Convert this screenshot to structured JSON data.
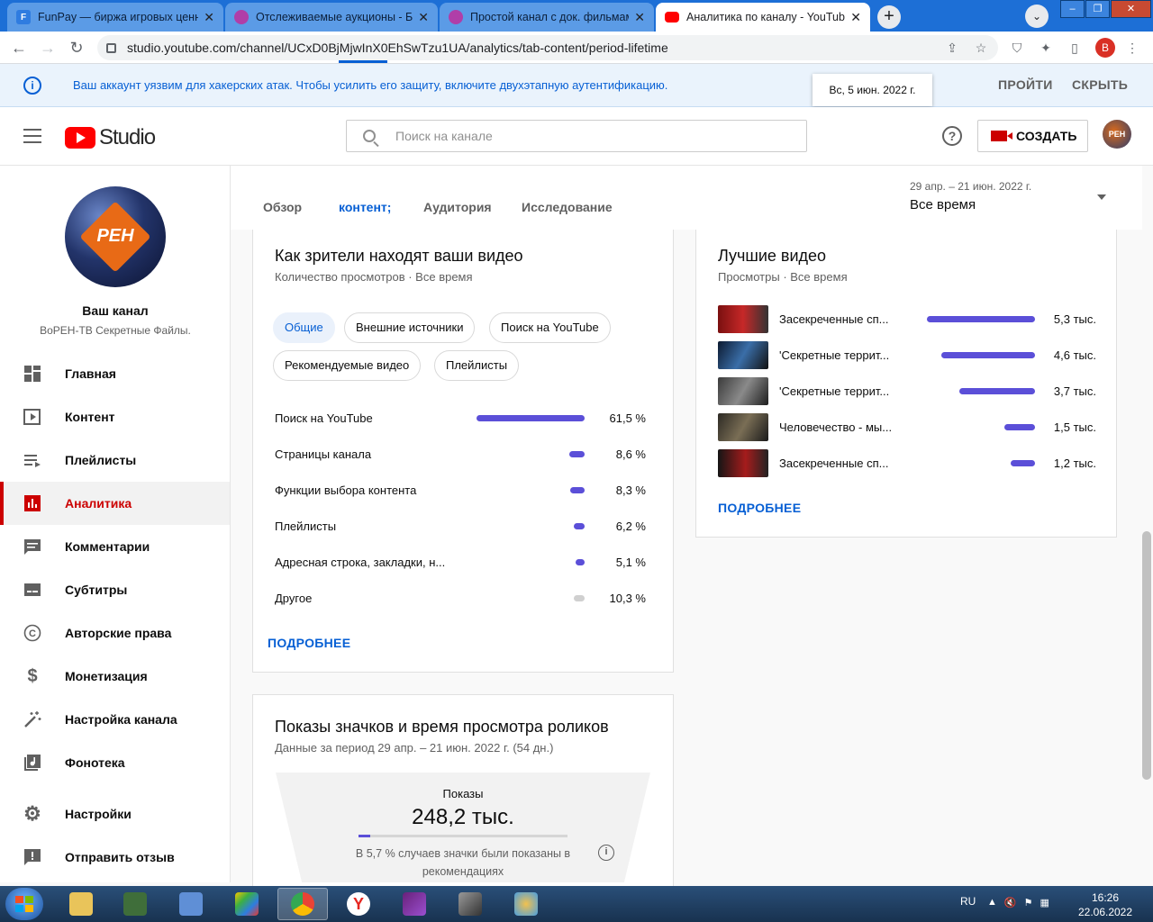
{
  "browser": {
    "tabs": [
      {
        "title": "FunPay — биржа игровых ценн",
        "favicon_color": "#2f7ce0",
        "favicon_letter": "F"
      },
      {
        "title": "Отслеживаемые аукционы - Би",
        "favicon_color": "#b03ea8",
        "favicon_letter": ""
      },
      {
        "title": "Простой канал с док. фильмам",
        "favicon_color": "#b03ea8",
        "favicon_letter": ""
      },
      {
        "title": "Аналитика по каналу - YouTube",
        "favicon_color": "#ff0000",
        "favicon_letter": ""
      }
    ],
    "new_tab": "+",
    "url": "studio.youtube.com/channel/UCxD0BjMjwInX0EhSwTzu1UA/analytics/tab-content/period-lifetime",
    "profile_letter": "B"
  },
  "banner": {
    "message": "Ваш аккаунт уязвим для хакерских атак. Чтобы усилить его защиту, включите двухэтапную аутентификацию.",
    "go_label": "ПРОЙТИ",
    "hide_label": "СКРЫТЬ",
    "tooltip": "Вс, 5 июн. 2022 г."
  },
  "header": {
    "logo_word": "Studio",
    "search_placeholder": "Поиск на канале",
    "help_glyph": "?",
    "create_label": "СОЗДАТЬ",
    "avatar_text": "РЕН"
  },
  "sidebar": {
    "avatar_text": "РЕН",
    "channel_title": "Ваш канал",
    "channel_name": "ВоРЕН-ТВ Секретные Файлы.",
    "items": [
      {
        "label": "Главная",
        "icon": "dashboard-icon"
      },
      {
        "label": "Контент",
        "icon": "content-icon"
      },
      {
        "label": "Плейлисты",
        "icon": "playlists-icon"
      },
      {
        "label": "Аналитика",
        "icon": "analytics-icon",
        "active": true
      },
      {
        "label": "Комментарии",
        "icon": "comments-icon"
      },
      {
        "label": "Субтитры",
        "icon": "subtitles-icon"
      },
      {
        "label": "Авторские права",
        "icon": "copyright-icon"
      },
      {
        "label": "Монетизация",
        "icon": "monetization-icon"
      },
      {
        "label": "Настройка канала",
        "icon": "customization-icon"
      },
      {
        "label": "Фонотека",
        "icon": "audio-library-icon"
      },
      {
        "label": "Настройки",
        "icon": "settings-icon"
      },
      {
        "label": "Отправить отзыв",
        "icon": "feedback-icon"
      }
    ]
  },
  "analytics_tabs": {
    "items": [
      "Обзор",
      "контент;",
      "Аудитория",
      "Исследование"
    ],
    "active": "контент;",
    "period_range": "29 апр. – 21 июн. 2022 г.",
    "period_value": "Все время"
  },
  "traffic_card": {
    "title": "Как зрители находят ваши видео",
    "subtitle": "Количество просмотров · Все время",
    "chips": [
      "Общие",
      "Внешние источники",
      "Поиск на YouTube",
      "Рекомендуемые видео",
      "Плейлисты"
    ],
    "selected_chip": "Общие",
    "rows": [
      {
        "label": "Поиск на YouTube",
        "value": 61.5,
        "display": "61,5 %"
      },
      {
        "label": "Страницы канала",
        "value": 8.6,
        "display": "8,6 %"
      },
      {
        "label": "Функции выбора контента",
        "value": 8.3,
        "display": "8,3 %"
      },
      {
        "label": "Плейлисты",
        "value": 6.2,
        "display": "6,2 %"
      },
      {
        "label": "Адресная строка, закладки, н...",
        "value": 5.1,
        "display": "5,1 %"
      },
      {
        "label": "Другое",
        "value": 10.3,
        "display": "10,3 %",
        "grey": true
      }
    ],
    "more_label": "ПОДРОБНЕЕ"
  },
  "top_videos_card": {
    "title": "Лучшие видео",
    "subtitle": "Просмотры · Все время",
    "videos": [
      {
        "title": "Засекреченные сп...",
        "value": 5.3,
        "display": "5,3 тыс."
      },
      {
        "title": "'Секретные террит...",
        "value": 4.6,
        "display": "4,6 тыс."
      },
      {
        "title": "'Секретные террит...",
        "value": 3.7,
        "display": "3,7 тыс."
      },
      {
        "title": "Человечество - мы...",
        "value": 1.5,
        "display": "1,5 тыс."
      },
      {
        "title": "Засекреченные сп...",
        "value": 1.2,
        "display": "1,2 тыс."
      }
    ],
    "more_label": "ПОДРОБНЕЕ"
  },
  "impressions_card": {
    "title": "Показы значков и время просмотра роликов",
    "subtitle": "Данные за период 29 апр. – 21 июн. 2022 г. (54 дн.)",
    "metric_label": "Показы",
    "metric_value": "248,2 тыс.",
    "rec_share": 5.7,
    "note": "В 5,7 % случаев значки были показаны в рекомендациях",
    "info_glyph": "i"
  },
  "taskbar": {
    "lang": "RU",
    "time": "16:26",
    "date": "22.06.2022"
  },
  "colors": {
    "accent": "#065fd4",
    "bar": "#5b4fd8",
    "active_nav": "#cc0000",
    "chrome_frame": "#1d6fd6"
  }
}
